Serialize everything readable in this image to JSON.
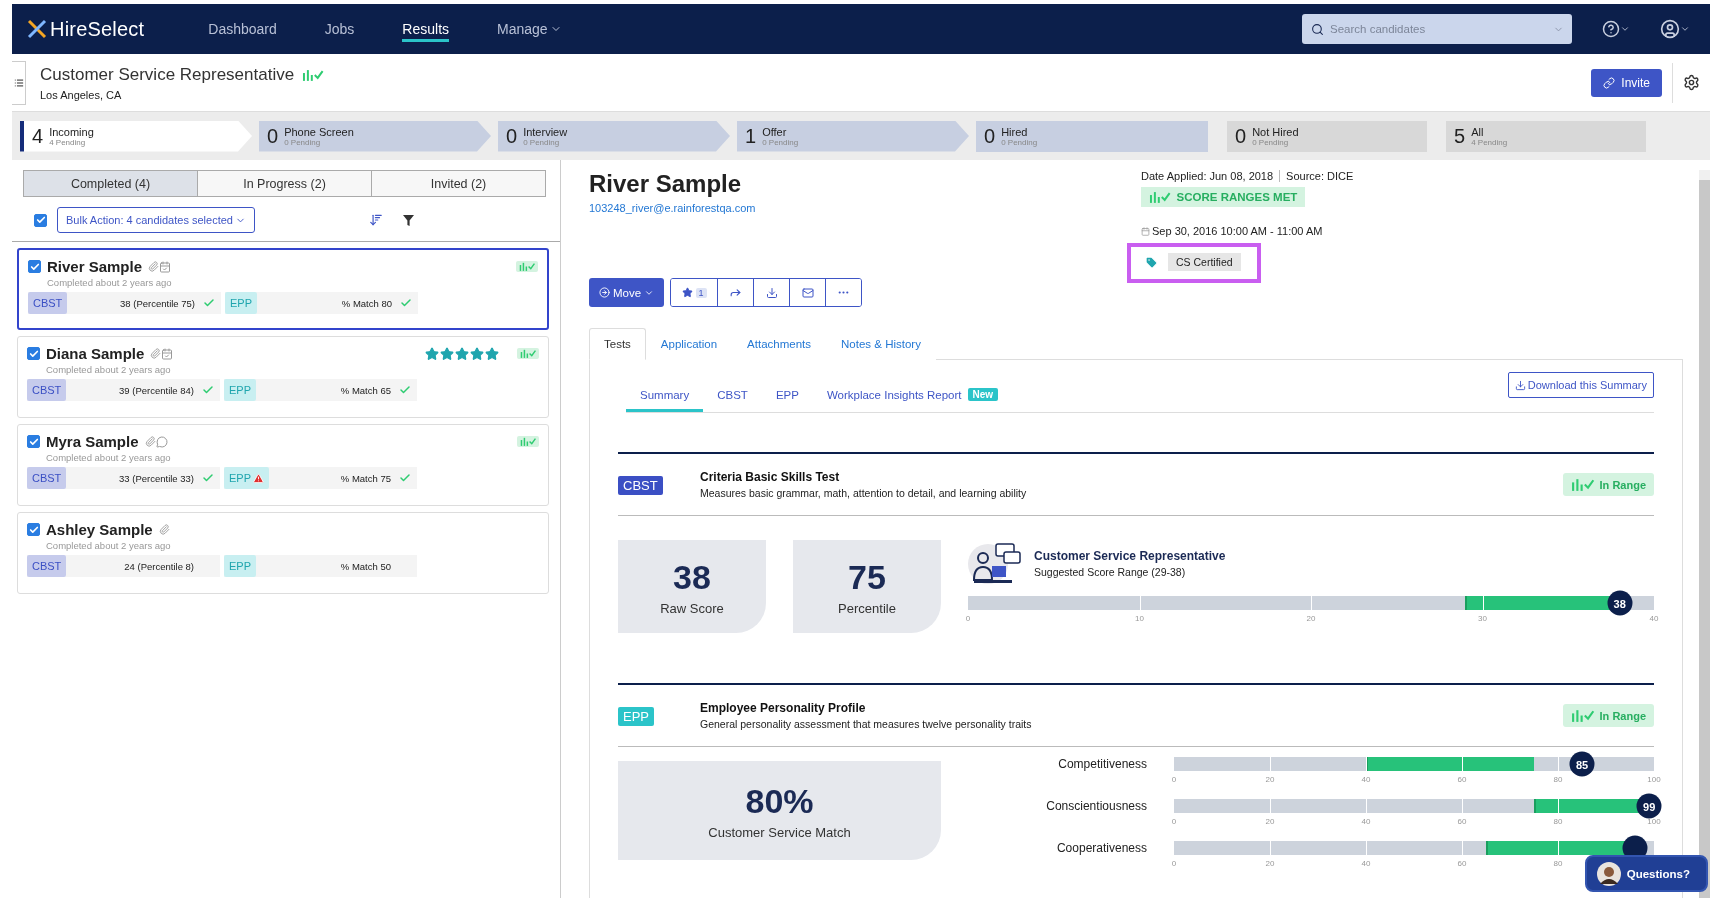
{
  "nav": {
    "logo": "HireSelect",
    "links": [
      {
        "label": "Dashboard",
        "selected": false,
        "dropdown": false
      },
      {
        "label": "Jobs",
        "selected": false,
        "dropdown": false
      },
      {
        "label": "Results",
        "selected": true,
        "dropdown": false
      },
      {
        "label": "Manage",
        "selected": false,
        "dropdown": true
      }
    ],
    "search": {
      "placeholder": "Search candidates"
    }
  },
  "job": {
    "title": "Customer Service Representative",
    "location": "Los Angeles, CA",
    "ranges_met": true,
    "invite_button": "Invite"
  },
  "pipeline": [
    {
      "count": "4",
      "label": "Incoming",
      "sub": "4 Pending",
      "kind": "step",
      "selected": true
    },
    {
      "count": "0",
      "label": "Phone Screen",
      "sub": "0 Pending",
      "kind": "step",
      "selected": false
    },
    {
      "count": "0",
      "label": "Interview",
      "sub": "0 Pending",
      "kind": "step",
      "selected": false
    },
    {
      "count": "1",
      "label": "Offer",
      "sub": "0 Pending",
      "kind": "step",
      "selected": false
    },
    {
      "count": "0",
      "label": "Hired",
      "sub": "0 Pending",
      "kind": "final",
      "selected": false
    },
    {
      "count": "0",
      "label": "Not Hired",
      "sub": "0 Pending",
      "kind": "closed",
      "selected": false
    },
    {
      "count": "5",
      "label": "All",
      "sub": "4 Pending",
      "kind": "closed",
      "selected": false
    }
  ],
  "candidate_tabs": [
    {
      "label": "Completed (4)",
      "selected": true
    },
    {
      "label": "In Progress (2)",
      "selected": false
    },
    {
      "label": "Invited (2)",
      "selected": false
    }
  ],
  "bulk_action": {
    "checked": true,
    "label": "Bulk Action: 4 candidates selected"
  },
  "candidates": [
    {
      "name": "River Sample",
      "icons": [
        {
          "kind": "attachment"
        },
        {
          "kind": "calendar"
        }
      ],
      "completed": "Completed about 2 years ago",
      "checked": true,
      "selected": true,
      "ranges_met": true,
      "tests": [
        {
          "kind": "cbst",
          "label": "CBST",
          "result": "38 (Percentile 75)",
          "passed": true,
          "warning": false
        },
        {
          "kind": "epp",
          "label": "EPP",
          "result": "% Match 80",
          "passed": true,
          "warning": false
        }
      ]
    },
    {
      "name": "Diana Sample",
      "icons": [
        {
          "kind": "attachment"
        },
        {
          "kind": "calendar"
        }
      ],
      "completed": "Completed about 2 years ago",
      "checked": true,
      "selected": false,
      "ranges_met": true,
      "stars": 5,
      "tests": [
        {
          "kind": "cbst",
          "label": "CBST",
          "result": "39 (Percentile 84)",
          "passed": true,
          "warning": false
        },
        {
          "kind": "epp",
          "label": "EPP",
          "result": "% Match 65",
          "passed": true,
          "warning": false
        }
      ]
    },
    {
      "name": "Myra Sample",
      "icons": [
        {
          "kind": "attachment"
        },
        {
          "kind": "comment"
        }
      ],
      "completed": "Completed about 2 years ago",
      "checked": true,
      "selected": false,
      "ranges_met": true,
      "tests": [
        {
          "kind": "cbst",
          "label": "CBST",
          "result": "33 (Percentile 33)",
          "passed": true,
          "warning": false
        },
        {
          "kind": "epp",
          "label": "EPP",
          "result": "% Match 75",
          "passed": true,
          "warning": true
        }
      ]
    },
    {
      "name": "Ashley Sample",
      "icons": [
        {
          "kind": "attachment"
        }
      ],
      "completed": "Completed about 2 years ago",
      "checked": true,
      "selected": false,
      "ranges_met": false,
      "tests": [
        {
          "kind": "cbst",
          "label": "CBST",
          "result": "24 (Percentile 8)",
          "passed": false,
          "warning": false
        },
        {
          "kind": "epp",
          "label": "EPP",
          "result": "% Match 50",
          "passed": false,
          "warning": false
        }
      ]
    }
  ],
  "profile": {
    "name": "River Sample",
    "email": "103248_river@e.rainforestqa.com",
    "date_applied": "Date Applied: Jun 08, 2018",
    "source": "Source: DICE",
    "ranges_badge": "SCORE RANGES MET",
    "interview": "Sep 30, 2016 10:00 AM - 11:00 AM",
    "tags": [
      "CS Certified"
    ],
    "highlighted": true,
    "move_button": "Move",
    "favorites": "1"
  },
  "detail_tabs": [
    {
      "label": "Tests",
      "selected": true
    },
    {
      "label": "Application",
      "selected": false
    },
    {
      "label": "Attachments",
      "selected": false
    },
    {
      "label": "Notes & History",
      "selected": false
    }
  ],
  "summary_tabs": [
    {
      "label": "Summary",
      "selected": true
    },
    {
      "label": "CBST",
      "selected": false
    },
    {
      "label": "EPP",
      "selected": false
    },
    {
      "label": "Workplace Insights Report",
      "selected": false,
      "badge": "New"
    }
  ],
  "download_button": "Download this Summary",
  "tests": [
    {
      "kind": "cbst",
      "badge": "CBST",
      "title": "Criteria Basic Skills Test",
      "description": "Measures basic grammar, math, attention to detail, and learning ability",
      "status": "In Range",
      "scores": [
        {
          "value": "38",
          "label": "Raw Score"
        },
        {
          "value": "75",
          "label": "Percentile"
        }
      ],
      "role": {
        "title": "Customer Service Representative",
        "range": "Suggested Score Range (29-38)"
      },
      "bars": [
        {
          "range": {
            "start": {
              "level": 0.725
            },
            "end": {
              "level": 0.95
            }
          },
          "marker": {
            "value": "38",
            "level": 0.95
          },
          "ticks": [
            "0",
            "10",
            "20",
            "30",
            "40"
          ]
        }
      ]
    },
    {
      "kind": "epp",
      "badge": "EPP",
      "title": "Employee Personality Profile",
      "description": "General personality assessment that measures twelve personality traits",
      "status": "In Range",
      "scores": [
        {
          "value": "80%",
          "label": "Customer Service Match"
        }
      ],
      "bars": [
        {
          "label": "Competitiveness",
          "range": {
            "start": {
              "level": 0.4
            },
            "end": {
              "level": 0.75
            }
          },
          "marker": {
            "value": "85",
            "level": 0.85
          },
          "ticks": [
            "0",
            "20",
            "40",
            "60",
            "80",
            "100"
          ]
        },
        {
          "label": "Conscientiousness",
          "range": {
            "start": {
              "level": 0.75
            },
            "end": {
              "level": 0.98
            }
          },
          "marker": {
            "value": "99",
            "level": 0.99
          },
          "ticks": [
            "0",
            "20",
            "40",
            "60",
            "80",
            "100"
          ]
        },
        {
          "label": "Cooperativeness",
          "range": {
            "start": {
              "level": 0.65
            },
            "end": {
              "level": 0.97
            }
          },
          "marker": {
            "level": 0.96
          },
          "ticks": [
            "0",
            "20",
            "40",
            "60",
            "80"
          ]
        }
      ]
    }
  ],
  "help_button": "Questions?"
}
